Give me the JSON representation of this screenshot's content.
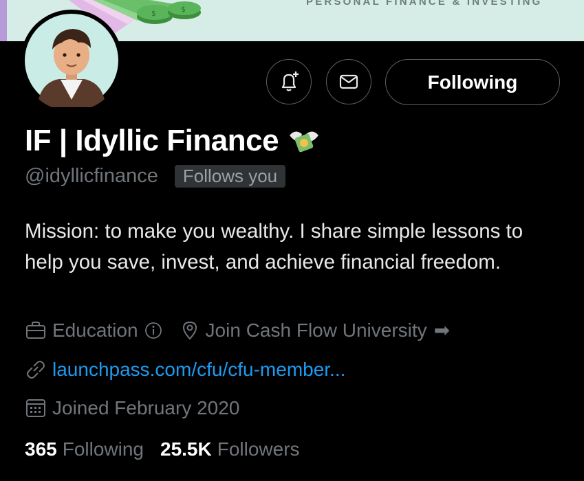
{
  "banner": {
    "tagline": "PERSONAL FINANCE & INVESTING",
    "background": "#d5ede6",
    "coin_label": "$"
  },
  "profile": {
    "display_name": "IF | Idyllic Finance",
    "name_emoji": "money-with-wings",
    "handle": "@idyllicfinance",
    "follows_you": "Follows you",
    "bio": "Mission: to make you wealthy. I share simple lessons to help you save, invest, and achieve financial freedom.",
    "category": "Education",
    "category_info_icon": "info-circle-icon",
    "location": "Join Cash Flow University",
    "location_arrow": "➡",
    "link": "launchpass.com/cfu/cfu-member...",
    "joined": "Joined February 2020",
    "following_count": "365",
    "following_label": "Following",
    "followers_count": "25.5K",
    "followers_label": "Followers"
  },
  "actions": {
    "notify_icon": "bell-plus-icon",
    "message_icon": "envelope-icon",
    "follow_button": "Following"
  },
  "colors": {
    "background": "#000000",
    "text": "#e7e9ea",
    "secondary_text": "#71767b",
    "link": "#1d9bf0",
    "border": "#5b6166"
  }
}
